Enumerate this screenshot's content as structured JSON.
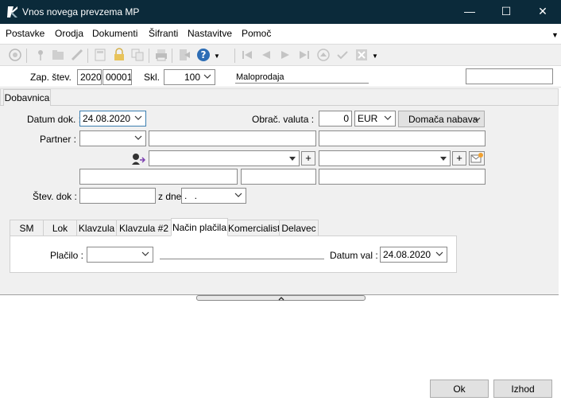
{
  "window": {
    "title": "Vnos novega prevzema MP",
    "minimize": "—",
    "maximize": "☐",
    "close": "✕"
  },
  "menu": [
    {
      "label": "Postavke"
    },
    {
      "label": "Orodja"
    },
    {
      "label": "Dokumenti"
    },
    {
      "label": "Šifranti"
    },
    {
      "label": "Nastavitve"
    },
    {
      "label": "Pomoč"
    }
  ],
  "header": {
    "zap_label": "Zap. štev.",
    "zap_year": "2020",
    "zap_number": "00001",
    "skl_label": "Skl.",
    "skl_value": "100",
    "skl_name": "Maloprodaja",
    "extra_field": ""
  },
  "main_tab": {
    "label": "Dobavnica"
  },
  "form": {
    "datum_dok_label": "Datum dok. :",
    "datum_dok_value": "24.08.2020",
    "obrac_valuta_label": "Obrač. valuta :",
    "rate_value": "0",
    "currency_value": "EUR",
    "domestic_button": "Domača nabava",
    "partner_label": "Partner :",
    "stev_dok_label": "Štev. dok :",
    "z_dne_label": "z dne",
    "z_dne_value": ". ."
  },
  "sub_tabs": [
    {
      "label": "SM"
    },
    {
      "label": "Lok"
    },
    {
      "label": "Klavzula"
    },
    {
      "label": "Klavzula #2"
    },
    {
      "label": "Način plačila"
    },
    {
      "label": "Komercialist"
    },
    {
      "label": "Delavec"
    }
  ],
  "payment": {
    "placilo_label": "Plačilo :",
    "placilo_value": "",
    "datum_val_label": "Datum val :",
    "datum_val_value": "24.08.2020"
  },
  "footer": {
    "ok_label": "Ok",
    "izhod_label": "Izhod"
  },
  "colors": {
    "titlebar": "#0b2a3a",
    "panel": "#f0f0f0",
    "focus_border": "#3c7fb1"
  }
}
